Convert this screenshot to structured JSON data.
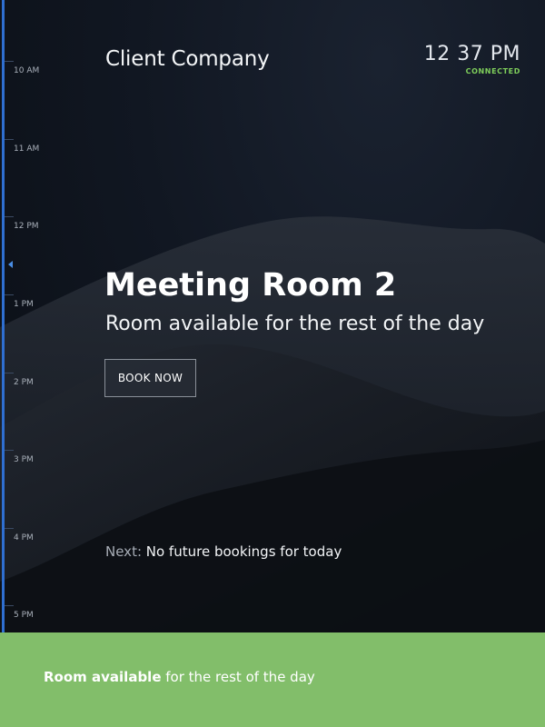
{
  "header": {
    "company": "Client Company",
    "clock_time": "12 37 PM",
    "connection_status": "CONNECTED"
  },
  "timeline": {
    "hours": [
      "10 AM",
      "11 AM",
      "12 PM",
      "1 PM",
      "2 PM",
      "3 PM",
      "4 PM",
      "5 PM"
    ]
  },
  "main": {
    "room_name": "Meeting Room 2",
    "availability_text": "Room available for the rest of the day",
    "book_button_label": "BOOK NOW",
    "next_prefix": "Next:",
    "next_value": "No future bookings for today"
  },
  "footer": {
    "status_strong": "Room available",
    "status_rest": " for the rest of the day"
  },
  "colors": {
    "timeline_accent": "#2f6fd1",
    "connected_green": "#7fcf5b",
    "footer_green": "#82be6a",
    "background_dark": "#0e1218"
  },
  "icons": {
    "now_marker": "triangle-left"
  }
}
